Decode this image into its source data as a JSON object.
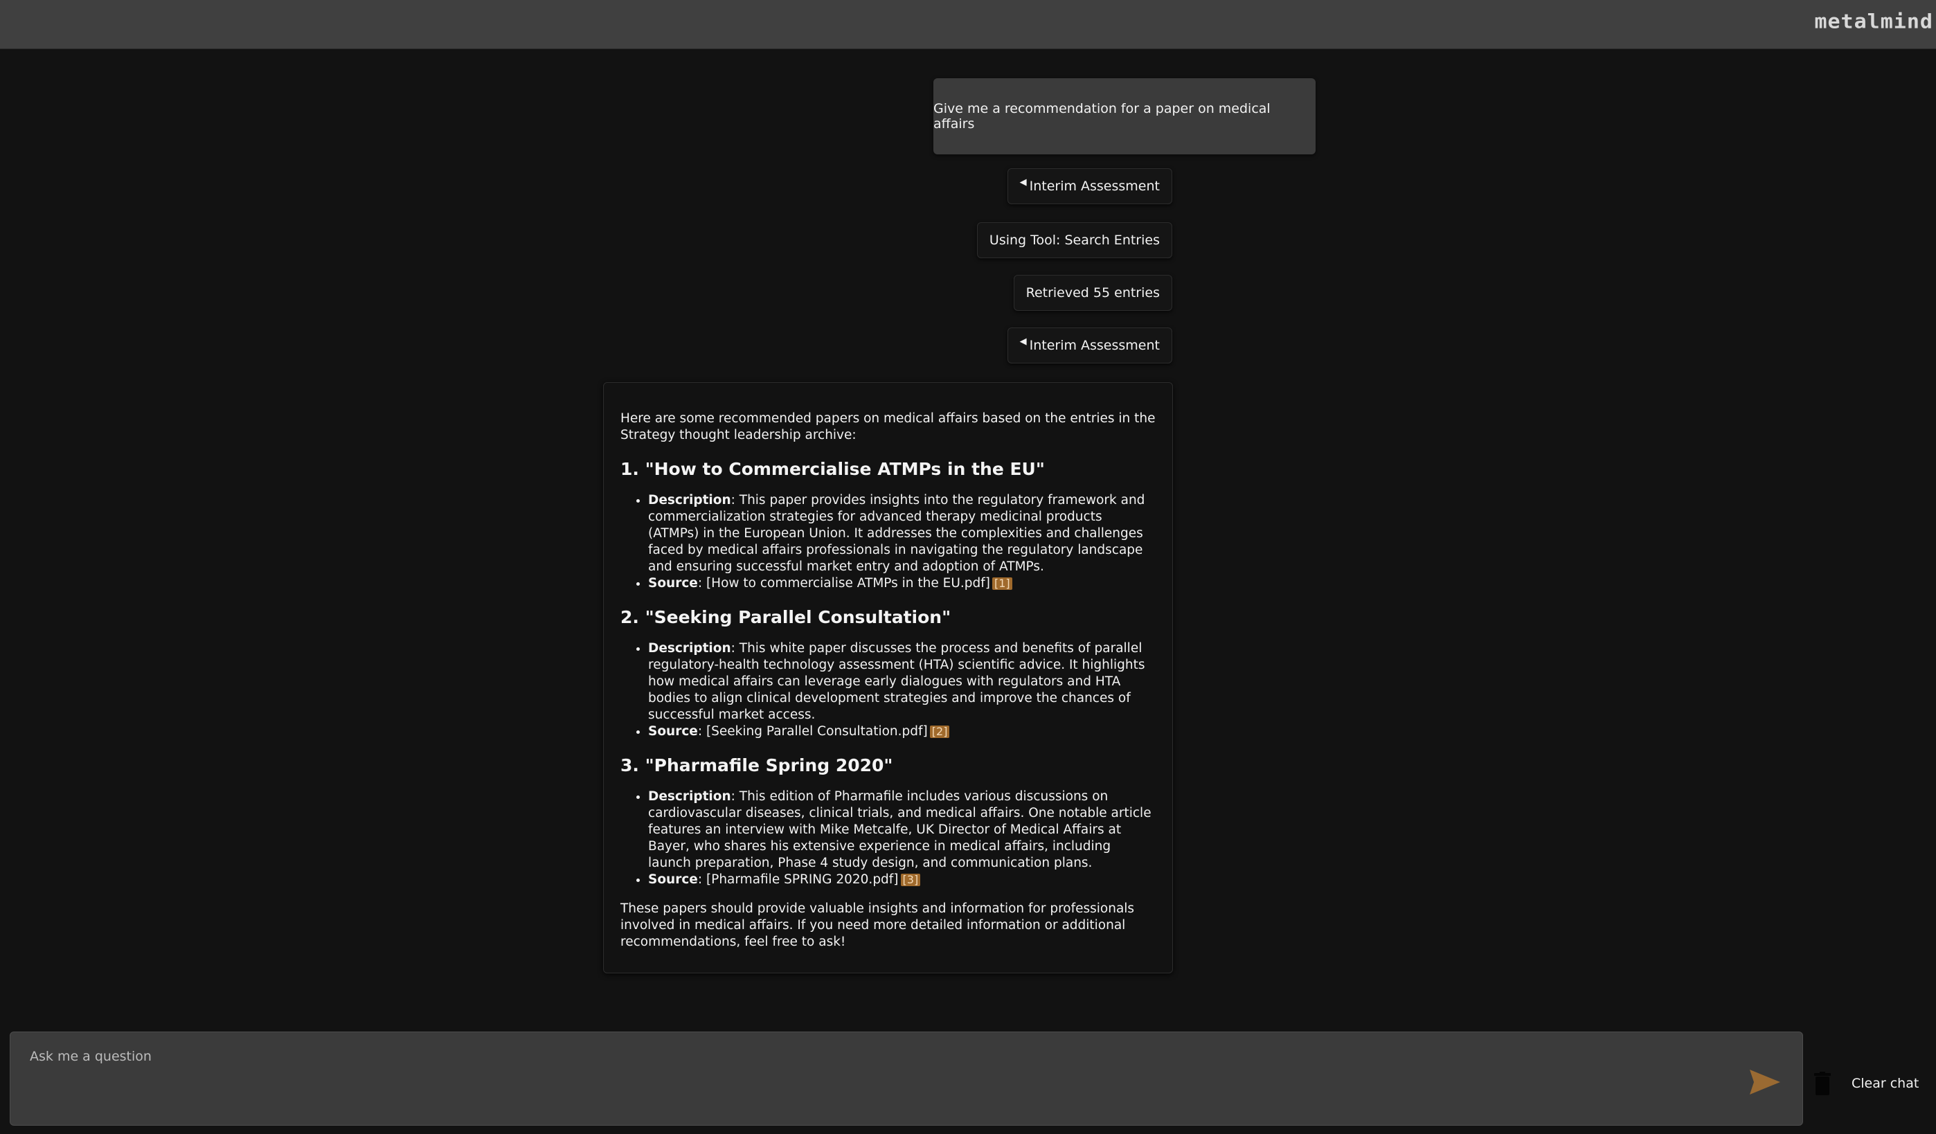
{
  "brand": {
    "logo_text": "metalmind"
  },
  "conversation": {
    "user_message": "Give me a recommendation for a paper on medical affairs",
    "status_chips": [
      {
        "label": "Interim Assessment",
        "icon": "triangle-left-icon"
      },
      {
        "label": "Using Tool: Search Entries",
        "icon": ""
      },
      {
        "label": "Retrieved 55 entries",
        "icon": ""
      },
      {
        "label": "Interim Assessment",
        "icon": "triangle-left-icon"
      }
    ],
    "answer": {
      "intro": "Here are some recommended papers on medical affairs based on the entries in the Strategy thought leadership archive:",
      "papers": [
        {
          "heading": "1. \"How to Commercialise ATMPs in the EU\"",
          "description_label": "Description",
          "description": ": This paper provides insights into the regulatory framework and commercialization strategies for advanced therapy medicinal products (ATMPs) in the European Union. It addresses the complexities and challenges faced by medical affairs professionals in navigating the regulatory landscape and ensuring successful market entry and adoption of ATMPs.",
          "source_label": "Source",
          "source": ": [How to commercialise ATMPs in the EU.pdf]",
          "citation": "[1]"
        },
        {
          "heading": "2. \"Seeking Parallel Consultation\"",
          "description_label": "Description",
          "description": ": This white paper discusses the process and benefits of parallel regulatory-health technology assessment (HTA) scientific advice. It highlights how medical affairs can leverage early dialogues with regulators and HTA bodies to align clinical development strategies and improve the chances of successful market access.",
          "source_label": "Source",
          "source": ": [Seeking Parallel Consultation.pdf]",
          "citation": "[2]"
        },
        {
          "heading": "3. \"Pharmafile Spring 2020\"",
          "description_label": "Description",
          "description": ": This edition of Pharmafile includes various discussions on cardiovascular diseases, clinical trials, and medical affairs. One notable article features an interview with Mike Metcalfe, UK Director of Medical Affairs at Bayer, who shares his extensive experience in medical affairs, including launch preparation, Phase 4 study design, and communication plans.",
          "source_label": "Source",
          "source": ": [Pharmafile SPRING 2020.pdf]",
          "citation": "[3]"
        }
      ],
      "outro": "These papers should provide valuable insights and information for professionals involved in medical affairs. If you need more detailed information or additional recommendations, feel free to ask!"
    }
  },
  "composer": {
    "placeholder": "Ask me a question",
    "value": "",
    "send_icon": "send-icon"
  },
  "actions": {
    "clear_chat_label": "Clear chat",
    "clear_icon": "trash-icon"
  },
  "colors": {
    "background": "#121212",
    "topbar": "#404040",
    "accent": "#a06a2c",
    "send_icon": "#9a6a32"
  }
}
